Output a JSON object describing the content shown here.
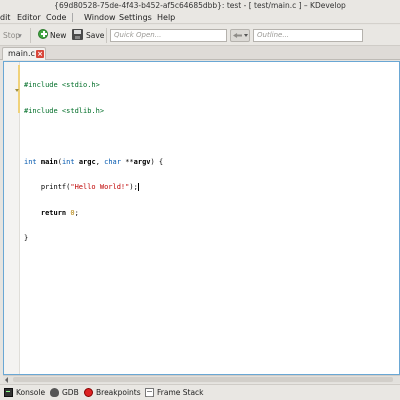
{
  "window": {
    "title": "{69d80528-75de-4f43-b452-af5c64685dbb}:  test - [ test/main.c ] – KDevelop"
  },
  "menubar": {
    "items": [
      "dit",
      "Editor",
      "Code",
      "Window",
      "Settings",
      "Help"
    ]
  },
  "toolbar": {
    "stop_label": "Stop",
    "new_label": "New",
    "save_label": "Save",
    "quick_open_placeholder": "Quick Open...",
    "outline_placeholder": "Outline..."
  },
  "tabs": [
    {
      "label": "main.c",
      "active": true
    }
  ],
  "editor": {
    "lines": [
      "#include <stdio.h>",
      "#include <stdlib.h>",
      "",
      "int main(int argc, char **argv) {",
      "    printf(\"Hello World!\");",
      "    return 0;",
      "}"
    ]
  },
  "bottom_tools": [
    {
      "label": "Konsole",
      "icon": "konsole-icon"
    },
    {
      "label": "GDB",
      "icon": "gdb-icon"
    },
    {
      "label": "Breakpoints",
      "icon": "breakpoint-icon"
    },
    {
      "label": "Frame Stack",
      "icon": "frame-stack-icon"
    }
  ],
  "colors": {
    "editor_border": "#6aa7d4",
    "preprocessor": "#006e28",
    "type": "#0057ae",
    "string": "#bf0303",
    "number": "#b07e00"
  }
}
